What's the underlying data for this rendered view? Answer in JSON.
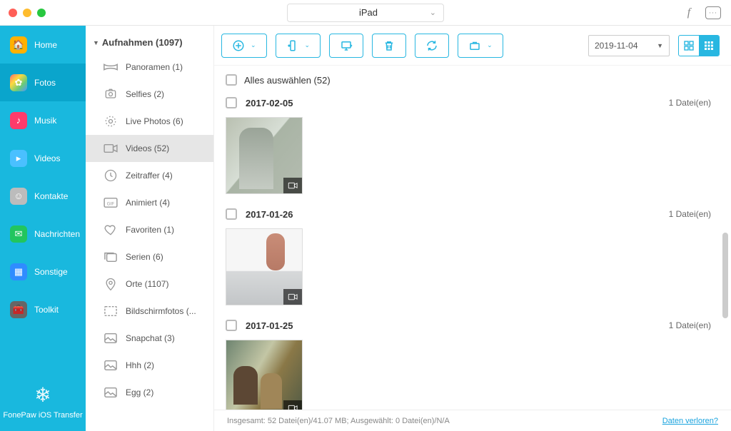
{
  "device_name": "iPad",
  "sidebar": [
    {
      "key": "home",
      "label": "Home"
    },
    {
      "key": "fotos",
      "label": "Fotos"
    },
    {
      "key": "musik",
      "label": "Musik"
    },
    {
      "key": "videos",
      "label": "Videos"
    },
    {
      "key": "kontakte",
      "label": "Kontakte"
    },
    {
      "key": "nachrichten",
      "label": "Nachrichten"
    },
    {
      "key": "sonstige",
      "label": "Sonstige"
    },
    {
      "key": "toolkit",
      "label": "Toolkit"
    }
  ],
  "app_name": "FonePaw iOS Transfer",
  "subnav_title": "Aufnahmen (1097)",
  "categories": [
    {
      "label": "Panoramen (1)",
      "icon": "pano"
    },
    {
      "label": "Selfies (2)",
      "icon": "selfie"
    },
    {
      "label": "Live Photos (6)",
      "icon": "live"
    },
    {
      "label": "Videos (52)",
      "icon": "video",
      "active": true
    },
    {
      "label": "Zeitraffer (4)",
      "icon": "time"
    },
    {
      "label": "Animiert (4)",
      "icon": "gif"
    },
    {
      "label": "Favoriten (1)",
      "icon": "fav"
    },
    {
      "label": "Serien (6)",
      "icon": "burst"
    },
    {
      "label": "Orte (1107)",
      "icon": "loc"
    },
    {
      "label": "Bildschirmfotos (...",
      "icon": "screen"
    },
    {
      "label": "Snapchat (3)",
      "icon": "album"
    },
    {
      "label": "Hhh (2)",
      "icon": "album"
    },
    {
      "label": "Egg (2)",
      "icon": "album"
    }
  ],
  "date_filter": "2019-11-04",
  "select_all_label": "Alles auswählen (52)",
  "groups": [
    {
      "date": "2017-02-05",
      "count": "1 Datei(en)",
      "thumb": "t1"
    },
    {
      "date": "2017-01-26",
      "count": "1 Datei(en)",
      "thumb": "t2"
    },
    {
      "date": "2017-01-25",
      "count": "1 Datei(en)",
      "thumb": "t3"
    }
  ],
  "status_text": "Insgesamt: 52 Datei(en)/41.07 MB; Ausgewählt: 0 Datei(en)/N/A",
  "lost_label": "Daten verloren?"
}
